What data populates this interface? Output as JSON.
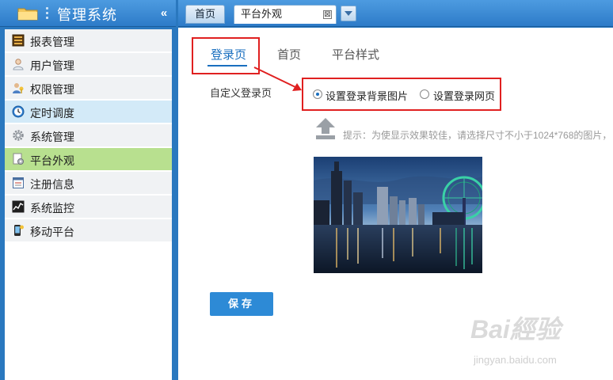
{
  "sidebar": {
    "title": "管理系统",
    "collapse_glyph": "«",
    "items": [
      {
        "label": "报表管理",
        "icon": "report-icon"
      },
      {
        "label": "用户管理",
        "icon": "user-icon"
      },
      {
        "label": "权限管理",
        "icon": "permission-icon"
      },
      {
        "label": "定时调度",
        "icon": "clock-icon"
      },
      {
        "label": "系统管理",
        "icon": "gear-icon"
      },
      {
        "label": "平台外观",
        "icon": "appearance-icon"
      },
      {
        "label": "注册信息",
        "icon": "registration-icon"
      },
      {
        "label": "系统监控",
        "icon": "monitor-chart-icon"
      },
      {
        "label": "移动平台",
        "icon": "mobile-icon"
      }
    ]
  },
  "tabs": {
    "home": "首页",
    "current": "平台外观",
    "close_glyph": "⊠"
  },
  "content": {
    "subtabs": [
      "登录页",
      "首页",
      "平台样式"
    ],
    "custom_login_label": "自定义登录页",
    "radio_options": [
      {
        "label": "设置登录背景图片",
        "selected": true
      },
      {
        "label": "设置登录网页",
        "selected": false
      }
    ],
    "hint": "提示：为使显示效果较佳，请选择尺寸不小于1024*768的图片，",
    "save_label": "保存"
  },
  "watermark": {
    "brand": "Bai經验",
    "url": "jingyan.baidu.com"
  },
  "colors": {
    "header_blue": "#2a78bf",
    "active_item": "#b8e08f",
    "timer_item": "#d3eaf8",
    "highlight_red": "#e02020",
    "accent": "#1a6fbf",
    "save_button": "#2d8ad6"
  }
}
